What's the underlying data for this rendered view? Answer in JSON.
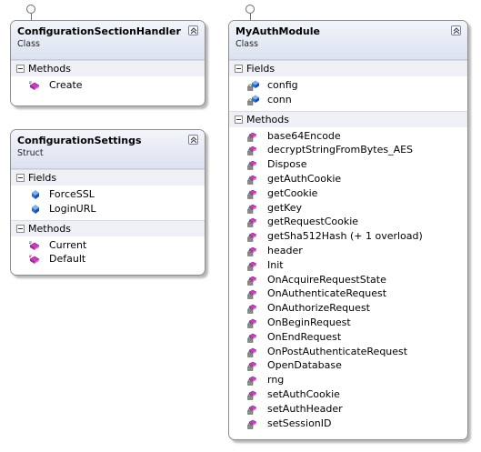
{
  "boxes": {
    "csh": {
      "title": "ConfigurationSectionHandler",
      "stereotype": "Class",
      "sections": {
        "methods": {
          "label": "Methods",
          "items": [
            {
              "name": "Create",
              "icon": "public-method-icon"
            }
          ]
        }
      }
    },
    "cs": {
      "title": "ConfigurationSettings",
      "stereotype": "Struct",
      "sections": {
        "fields": {
          "label": "Fields",
          "items": [
            {
              "name": "ForceSSL",
              "icon": "public-field-icon"
            },
            {
              "name": "LoginURL",
              "icon": "public-field-icon"
            }
          ]
        },
        "methods": {
          "label": "Methods",
          "items": [
            {
              "name": "Current",
              "icon": "public-method-icon"
            },
            {
              "name": "Default",
              "icon": "public-method-icon"
            }
          ]
        }
      }
    },
    "mam": {
      "title": "MyAuthModule",
      "stereotype": "Class",
      "sections": {
        "fields": {
          "label": "Fields",
          "items": [
            {
              "name": "config",
              "icon": "private-field-icon"
            },
            {
              "name": "conn",
              "icon": "private-field-icon"
            }
          ]
        },
        "methods": {
          "label": "Methods",
          "items": [
            {
              "name": "base64Encode",
              "icon": "private-method-icon"
            },
            {
              "name": "decryptStringFromBytes_AES",
              "icon": "private-method-icon"
            },
            {
              "name": "Dispose",
              "icon": "private-method-icon"
            },
            {
              "name": "getAuthCookie",
              "icon": "private-method-icon"
            },
            {
              "name": "getCookie",
              "icon": "private-method-icon"
            },
            {
              "name": "getKey",
              "icon": "private-method-icon"
            },
            {
              "name": "getRequestCookie",
              "icon": "private-method-icon"
            },
            {
              "name": "getSha512Hash (+ 1 overload)",
              "icon": "private-method-icon"
            },
            {
              "name": "header",
              "icon": "private-method-icon"
            },
            {
              "name": "Init",
              "icon": "private-method-icon"
            },
            {
              "name": "OnAcquireRequestState",
              "icon": "private-method-icon"
            },
            {
              "name": "OnAuthenticateRequest",
              "icon": "private-method-icon"
            },
            {
              "name": "OnAuthorizeRequest",
              "icon": "private-method-icon"
            },
            {
              "name": "OnBeginRequest",
              "icon": "private-method-icon"
            },
            {
              "name": "OnEndRequest",
              "icon": "private-method-icon"
            },
            {
              "name": "OnPostAuthenticateRequest",
              "icon": "private-method-icon"
            },
            {
              "name": "OpenDatabase",
              "icon": "private-method-icon"
            },
            {
              "name": "rng",
              "icon": "private-method-icon"
            },
            {
              "name": "setAuthCookie",
              "icon": "private-method-icon"
            },
            {
              "name": "setAuthHeader",
              "icon": "private-method-icon"
            },
            {
              "name": "setSessionID",
              "icon": "private-method-icon"
            }
          ]
        }
      }
    }
  },
  "colors": {
    "method_magenta": "#c83fbf",
    "field_blue": "#2f6fc7",
    "lock_gray": "#707070"
  }
}
